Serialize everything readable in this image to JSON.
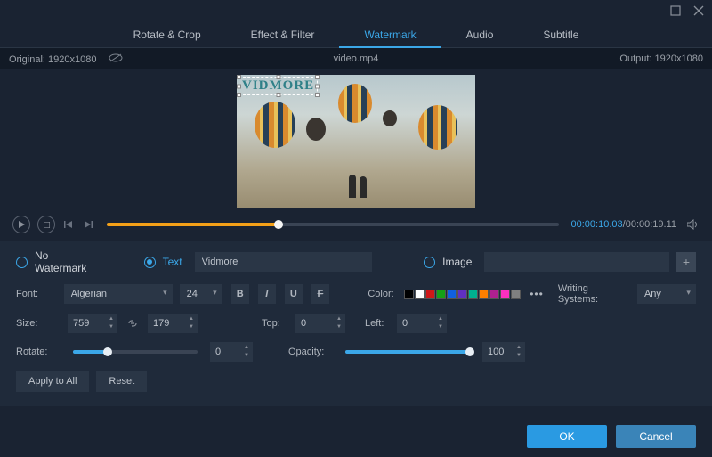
{
  "window": {
    "maximize_title": "Maximize",
    "close_title": "Close"
  },
  "tabs": {
    "rotate": "Rotate & Crop",
    "effect": "Effect & Filter",
    "watermark": "Watermark",
    "audio": "Audio",
    "subtitle": "Subtitle"
  },
  "filebar": {
    "original_label": "Original:",
    "original_res": "1920x1080",
    "filename": "video.mp4",
    "output_label": "Output:",
    "output_res": "1920x1080"
  },
  "watermark_overlay": {
    "text": "VIDMORE"
  },
  "playback": {
    "current": "00:00:10.03",
    "sep": "/",
    "total": "00:00:19.11",
    "progress_pct": 38
  },
  "wm_mode": {
    "none_label": "No Watermark",
    "text_label": "Text",
    "text_value": "Vidmore",
    "image_label": "Image",
    "image_value": ""
  },
  "font_row": {
    "label": "Font:",
    "family": "Algerian",
    "size": "24",
    "color_label": "Color:",
    "writing_label": "Writing Systems:",
    "writing_value": "Any"
  },
  "size_row": {
    "label": "Size:",
    "w": "759",
    "h": "179",
    "top_label": "Top:",
    "top": "0",
    "left_label": "Left:",
    "left": "0"
  },
  "rotate_row": {
    "label": "Rotate:",
    "value": "0",
    "pct": 28,
    "opacity_label": "Opacity:",
    "opacity_value": "100",
    "opacity_pct": 100
  },
  "swatches": [
    "#000000",
    "#ffffff",
    "#d01818",
    "#16a016",
    "#1060e0",
    "#6030c0",
    "#00b090",
    "#ff8000",
    "#b02090",
    "#ff30c0",
    "#808080"
  ],
  "buttons": {
    "apply_all": "Apply to All",
    "reset": "Reset",
    "ok": "OK",
    "cancel": "Cancel"
  }
}
